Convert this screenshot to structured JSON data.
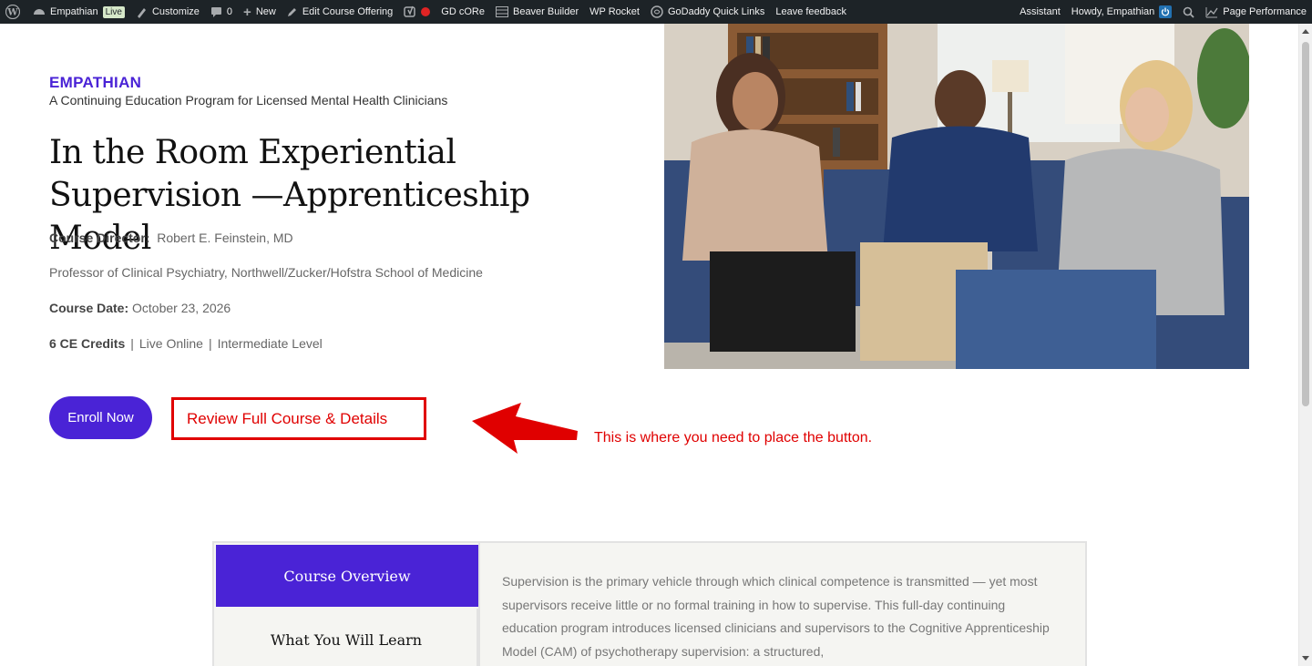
{
  "adminbar": {
    "site_name": "Empathian",
    "live_badge": "Live",
    "customize": "Customize",
    "comments_count": "0",
    "new": "New",
    "edit_course": "Edit Course Offering",
    "gd_core": "GD cORe",
    "beaver_builder": "Beaver Builder",
    "wp_rocket": "WP Rocket",
    "godaddy_links": "GoDaddy Quick Links",
    "leave_feedback": "Leave feedback",
    "assistant": "Assistant",
    "howdy": "Howdy, Empathian",
    "page_performance": "Page Performance"
  },
  "hero": {
    "brand": "EMPATHIAN",
    "tagline": "A Continuing Education Program for Licensed Mental Health Clinicians",
    "title": "In the Room Experiential Supervision —Apprenticeship Model",
    "director_label": "Course Director:",
    "director_name": "Robert E. Feinstein, MD",
    "affiliation": "Professor of Clinical Psychiatry, Northwell/Zucker/Hofstra School of Medicine",
    "date_label": "Course Date:",
    "date_value": "October 23, 2026",
    "credits": "6 CE Credits",
    "sep1": "|",
    "format": "Live Online",
    "sep2": "|",
    "level": "Intermediate Level",
    "enroll_label": "Enroll Now",
    "review_label": "Review Full Course & Details"
  },
  "annotation": {
    "text": "This is where you need to place the button."
  },
  "tabs": {
    "active": "Course Overview",
    "second": "What You Will Learn",
    "overview_text": "Supervision is the primary vehicle through which clinical competence is transmitted — yet most supervisors receive little or no formal training in how to supervise. This full-day continuing education program introduces licensed clinicians and supervisors to the Cognitive Apprenticeship Model (CAM) of psychotherapy supervision: a structured,"
  },
  "colors": {
    "brand": "#4a23d6",
    "annotation_red": "#e00000",
    "adminbar_bg": "#1d2327"
  }
}
